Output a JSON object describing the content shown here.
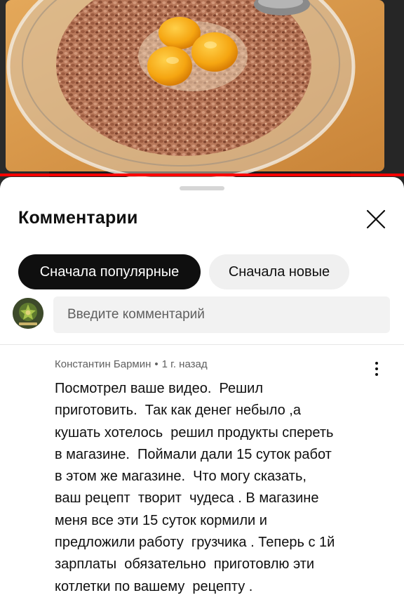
{
  "video": {
    "thumbnail_icon": "video-thumbnail-bowl-buckwheat-eggs"
  },
  "sheet": {
    "title": "Комментарии",
    "close_icon": "close-icon"
  },
  "sort_chips": {
    "popular": "Сначала популярные",
    "newest": "Сначала новые",
    "active": "popular"
  },
  "composer": {
    "placeholder": "Введите комментарий",
    "value": ""
  },
  "comment": {
    "author": "Константин Бармин",
    "separator": "•",
    "time": "1 г. назад",
    "lines": [
      "Посмотрел ваше видео.  Решил",
      "приготовить.  Так как денег небыло ,а",
      "кушать хотелось  решил продукты спереть",
      "в магазине.  Поймали дали 15 суток работ",
      "в этом же магазине.  Что могу сказать,",
      "ваш рецепт  творит  чудеса . В магазине",
      "меня все эти 15 суток кормили и",
      "предложили работу  грузчика . Теперь с 1й",
      "зарплаты  обязательно  приготовлю эти",
      "котлетки по вашему  рецепту ."
    ]
  },
  "colors": {
    "chip_active_bg": "#0f0f0f",
    "chip_inactive_bg": "#f0f0f0",
    "input_bg": "#f2f2f2",
    "meta_text": "#606060"
  }
}
